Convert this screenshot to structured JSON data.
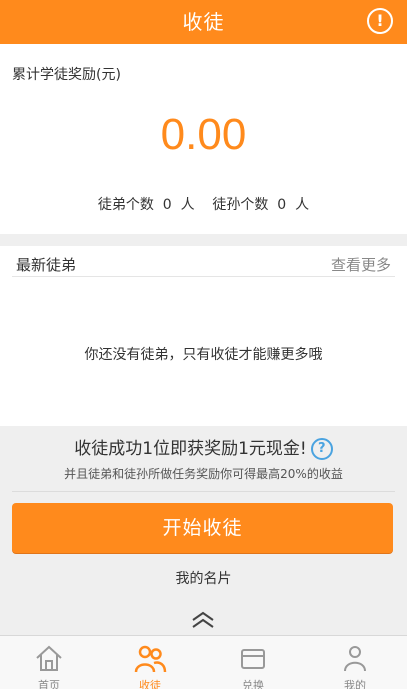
{
  "header": {
    "title": "收徒",
    "info_icon": "info-icon"
  },
  "earnings": {
    "label": "累计学徒奖励(元)",
    "amount": "0.00",
    "counts": "徒弟个数  0  人    徒孙个数  0  人"
  },
  "disciples": {
    "title": "最新徒弟",
    "more": "查看更多",
    "empty_text": "你还没有徒弟，只有收徒才能赚更多哦"
  },
  "promo": {
    "title": "收徒成功1位即获奖励1元现金!",
    "help_icon": "?",
    "subtitle": "并且徒弟和徒孙所做任务奖励你可得最高20%的收益"
  },
  "actions": {
    "start_button": "开始收徒",
    "card_link": "我的名片"
  },
  "tabbar": {
    "items": [
      {
        "label": "首页",
        "icon": "home-icon"
      },
      {
        "label": "收徒",
        "icon": "people-icon",
        "active": true
      },
      {
        "label": "兑换",
        "icon": "exchange-icon"
      },
      {
        "label": "我的",
        "icon": "person-icon"
      }
    ]
  },
  "colors": {
    "accent": "#ff8a1c",
    "help": "#4aa3e0"
  }
}
